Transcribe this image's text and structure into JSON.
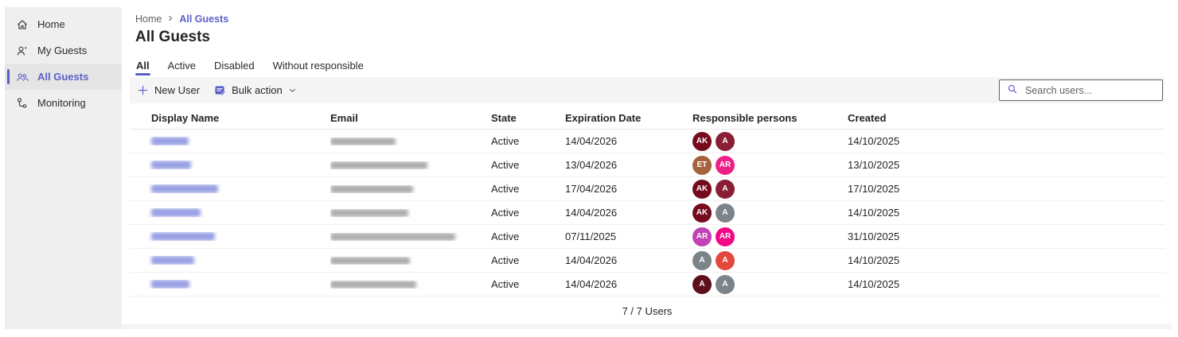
{
  "colors": {
    "accent": "#5b5fc7"
  },
  "sidebar": {
    "items": [
      {
        "label": "Home",
        "icon": "home-icon",
        "active": false
      },
      {
        "label": "My Guests",
        "icon": "person-star-icon",
        "active": false
      },
      {
        "label": "All Guests",
        "icon": "people-icon",
        "active": true
      },
      {
        "label": "Monitoring",
        "icon": "flowchart-icon",
        "active": false
      }
    ]
  },
  "breadcrumb": {
    "items": [
      {
        "label": "Home"
      },
      {
        "label": "All Guests"
      }
    ]
  },
  "page": {
    "title": "All Guests"
  },
  "tabs": [
    {
      "label": "All",
      "active": true
    },
    {
      "label": "Active",
      "active": false
    },
    {
      "label": "Disabled",
      "active": false
    },
    {
      "label": "Without responsible",
      "active": false
    }
  ],
  "toolbar": {
    "new_user_label": "New User",
    "bulk_action_label": "Bulk action"
  },
  "search": {
    "placeholder": "Search users..."
  },
  "table": {
    "columns": [
      "Display Name",
      "Email",
      "State",
      "Expiration Date",
      "Responsible persons",
      "Created"
    ],
    "rows": [
      {
        "name_redacted": true,
        "redacted_name_width": 47,
        "email_redacted": true,
        "redacted_email_width": 82,
        "state": "Active",
        "expiration_date": "14/04/2026",
        "responsible": [
          {
            "initials": "AK",
            "color": "#750b1c"
          },
          {
            "initials": "A",
            "color": "#8a1e35"
          }
        ],
        "created": "14/10/2025"
      },
      {
        "name_redacted": true,
        "redacted_name_width": 50,
        "email_redacted": true,
        "redacted_email_width": 122,
        "state": "Active",
        "expiration_date": "13/04/2026",
        "responsible": [
          {
            "initials": "ET",
            "color": "#a4633a"
          },
          {
            "initials": "AR",
            "color": "#ee2088"
          }
        ],
        "created": "13/10/2025"
      },
      {
        "name_redacted": true,
        "redacted_name_width": 84,
        "email_redacted": true,
        "redacted_email_width": 104,
        "state": "Active",
        "expiration_date": "17/04/2026",
        "responsible": [
          {
            "initials": "AK",
            "color": "#750b1c"
          },
          {
            "initials": "A",
            "color": "#8a1e35"
          }
        ],
        "created": "17/10/2025"
      },
      {
        "name_redacted": true,
        "redacted_name_width": 62,
        "email_redacted": true,
        "redacted_email_width": 98,
        "state": "Active",
        "expiration_date": "14/04/2026",
        "responsible": [
          {
            "initials": "AK",
            "color": "#750b1c"
          },
          {
            "initials": "A",
            "color": "#7b8489"
          }
        ],
        "created": "14/10/2025"
      },
      {
        "name_redacted": true,
        "redacted_name_width": 80,
        "email_redacted": true,
        "redacted_email_width": 157,
        "state": "Active",
        "expiration_date": "07/11/2025",
        "responsible": [
          {
            "initials": "AR",
            "color": "#c340b5"
          },
          {
            "initials": "AR",
            "color": "#f20884"
          }
        ],
        "created": "31/10/2025"
      },
      {
        "name_redacted": true,
        "redacted_name_width": 54,
        "email_redacted": true,
        "redacted_email_width": 100,
        "state": "Active",
        "expiration_date": "14/04/2026",
        "responsible": [
          {
            "initials": "A",
            "color": "#7b8489"
          },
          {
            "initials": "A",
            "color": "#e3483e"
          }
        ],
        "created": "14/10/2025"
      },
      {
        "name_redacted": true,
        "redacted_name_width": 48,
        "email_redacted": true,
        "redacted_email_width": 108,
        "state": "Active",
        "expiration_date": "14/04/2026",
        "responsible": [
          {
            "initials": "A",
            "color": "#5e0f1e"
          },
          {
            "initials": "A",
            "color": "#7b8489"
          }
        ],
        "created": "14/10/2025"
      }
    ]
  },
  "footer": {
    "count_label": "7 / 7 Users"
  }
}
